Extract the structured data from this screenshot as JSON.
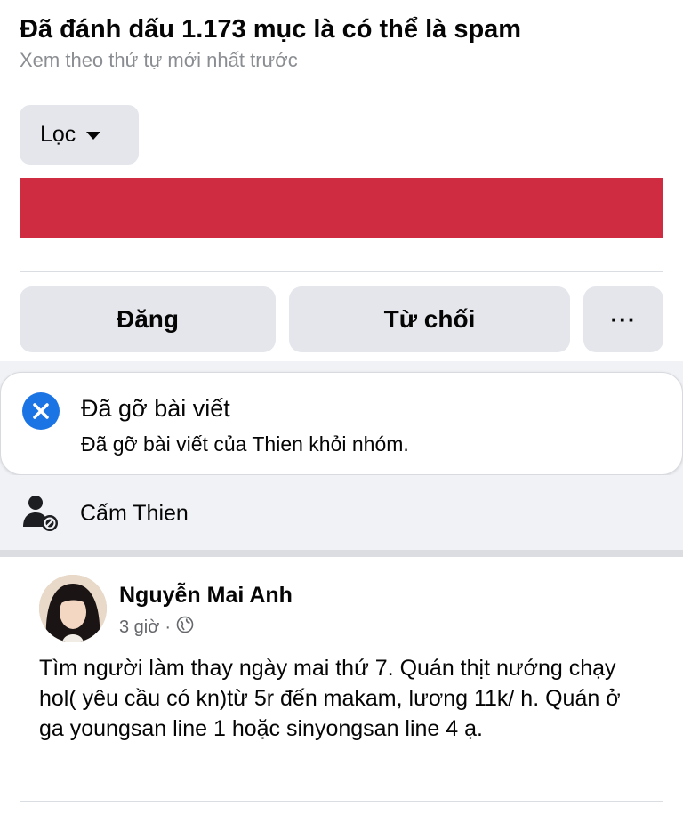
{
  "header": {
    "title": "Đã đánh dấu 1.173 mục là có thể là spam",
    "subtitle": "Xem theo thứ tự mới nhất trước"
  },
  "filter": {
    "label": "Lọc"
  },
  "actions": {
    "post_label": "Đăng",
    "reject_label": "Từ chối",
    "more_label": "···"
  },
  "toast": {
    "title": "Đã gỡ bài viết",
    "body": "Đã gỡ bài viết của Thien khỏi nhóm.",
    "icon": "close-circle-icon"
  },
  "ban": {
    "label": "Cấm Thien",
    "icon": "user-block-icon"
  },
  "post": {
    "author": "Nguyễn Mai Anh",
    "time": "3 giờ",
    "separator": "·",
    "privacy_icon": "globe-icon",
    "text": "Tìm người làm thay ngày mai thứ 7. Quán thịt nướng chạy hol( yêu cầu có kn)từ 5r đến makam, lương 11k/ h. Quán ở ga youngsan line 1 hoặc sinyongsan line 4 ạ."
  },
  "colors": {
    "accent": "#1b74e4",
    "alert_bar": "#cf2c41",
    "button_bg": "#e4e6eb",
    "muted_text": "#65676b"
  }
}
